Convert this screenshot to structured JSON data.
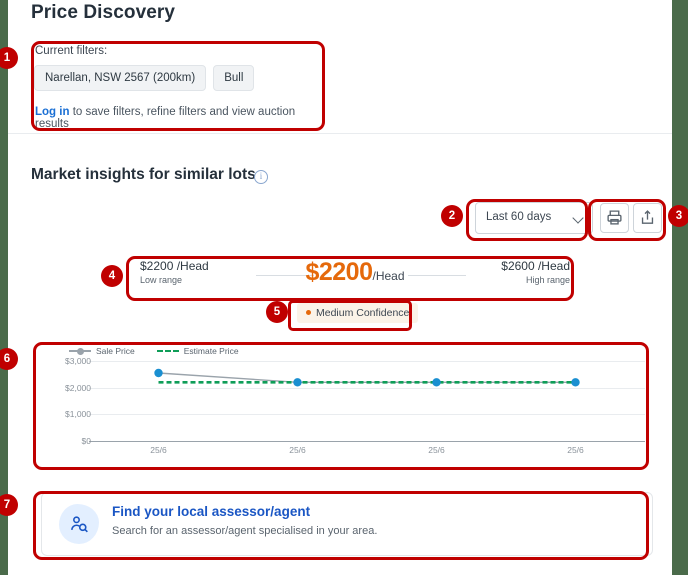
{
  "header": {
    "title": "Price Discovery"
  },
  "filters": {
    "label": "Current filters:",
    "chips": [
      {
        "label": "Narellan, NSW 2567 (200km)"
      },
      {
        "label": "Bull"
      }
    ],
    "login_link": "Log in",
    "login_rest": " to save filters, refine filters and view auction results"
  },
  "insights": {
    "title": "Market insights for similar lots",
    "info_icon": "info-icon",
    "range_select": {
      "value": "Last 60 days",
      "chevron": "chevron-down-icon"
    },
    "print_button": "print-icon",
    "share_button": "share-icon",
    "price": {
      "low_amount": "$2200 /Head",
      "low_caption": "Low range",
      "main_amount": "$2200",
      "main_unit": "/Head",
      "high_amount": "$2600 /Head",
      "high_caption": "High range",
      "accent_color": "#e5690b"
    },
    "confidence": {
      "label": "Medium Confidence",
      "dot_color": "#e5690b"
    }
  },
  "chart_data": {
    "type": "line",
    "title": "",
    "xlabel": "",
    "ylabel": "",
    "ylim": [
      0,
      3000
    ],
    "yticks": [
      0,
      1000,
      2000,
      3000
    ],
    "ytick_labels": [
      "$0",
      "$1,000",
      "$2,000",
      "$3,000"
    ],
    "grid": true,
    "legend_position": "top-left",
    "x": [
      "25/6",
      "25/6",
      "25/6",
      "25/6"
    ],
    "series": [
      {
        "name": "Sale Price",
        "values": [
          2550,
          2200,
          2200,
          2200
        ],
        "color": "#9aa3ab",
        "style": "solid",
        "marker_color": "#1a8fd1"
      },
      {
        "name": "Estimate Price",
        "values": [
          2200,
          2200,
          2200,
          2200
        ],
        "color": "#0f9d58",
        "style": "dashed"
      }
    ]
  },
  "cta": {
    "icon": "person-search-icon",
    "title": "Find your local assessor/agent",
    "subtitle": "Search for an assessor/agent specialised in your area."
  },
  "annotations": {
    "badges": [
      "1",
      "2",
      "3",
      "4",
      "5",
      "6",
      "7"
    ]
  }
}
